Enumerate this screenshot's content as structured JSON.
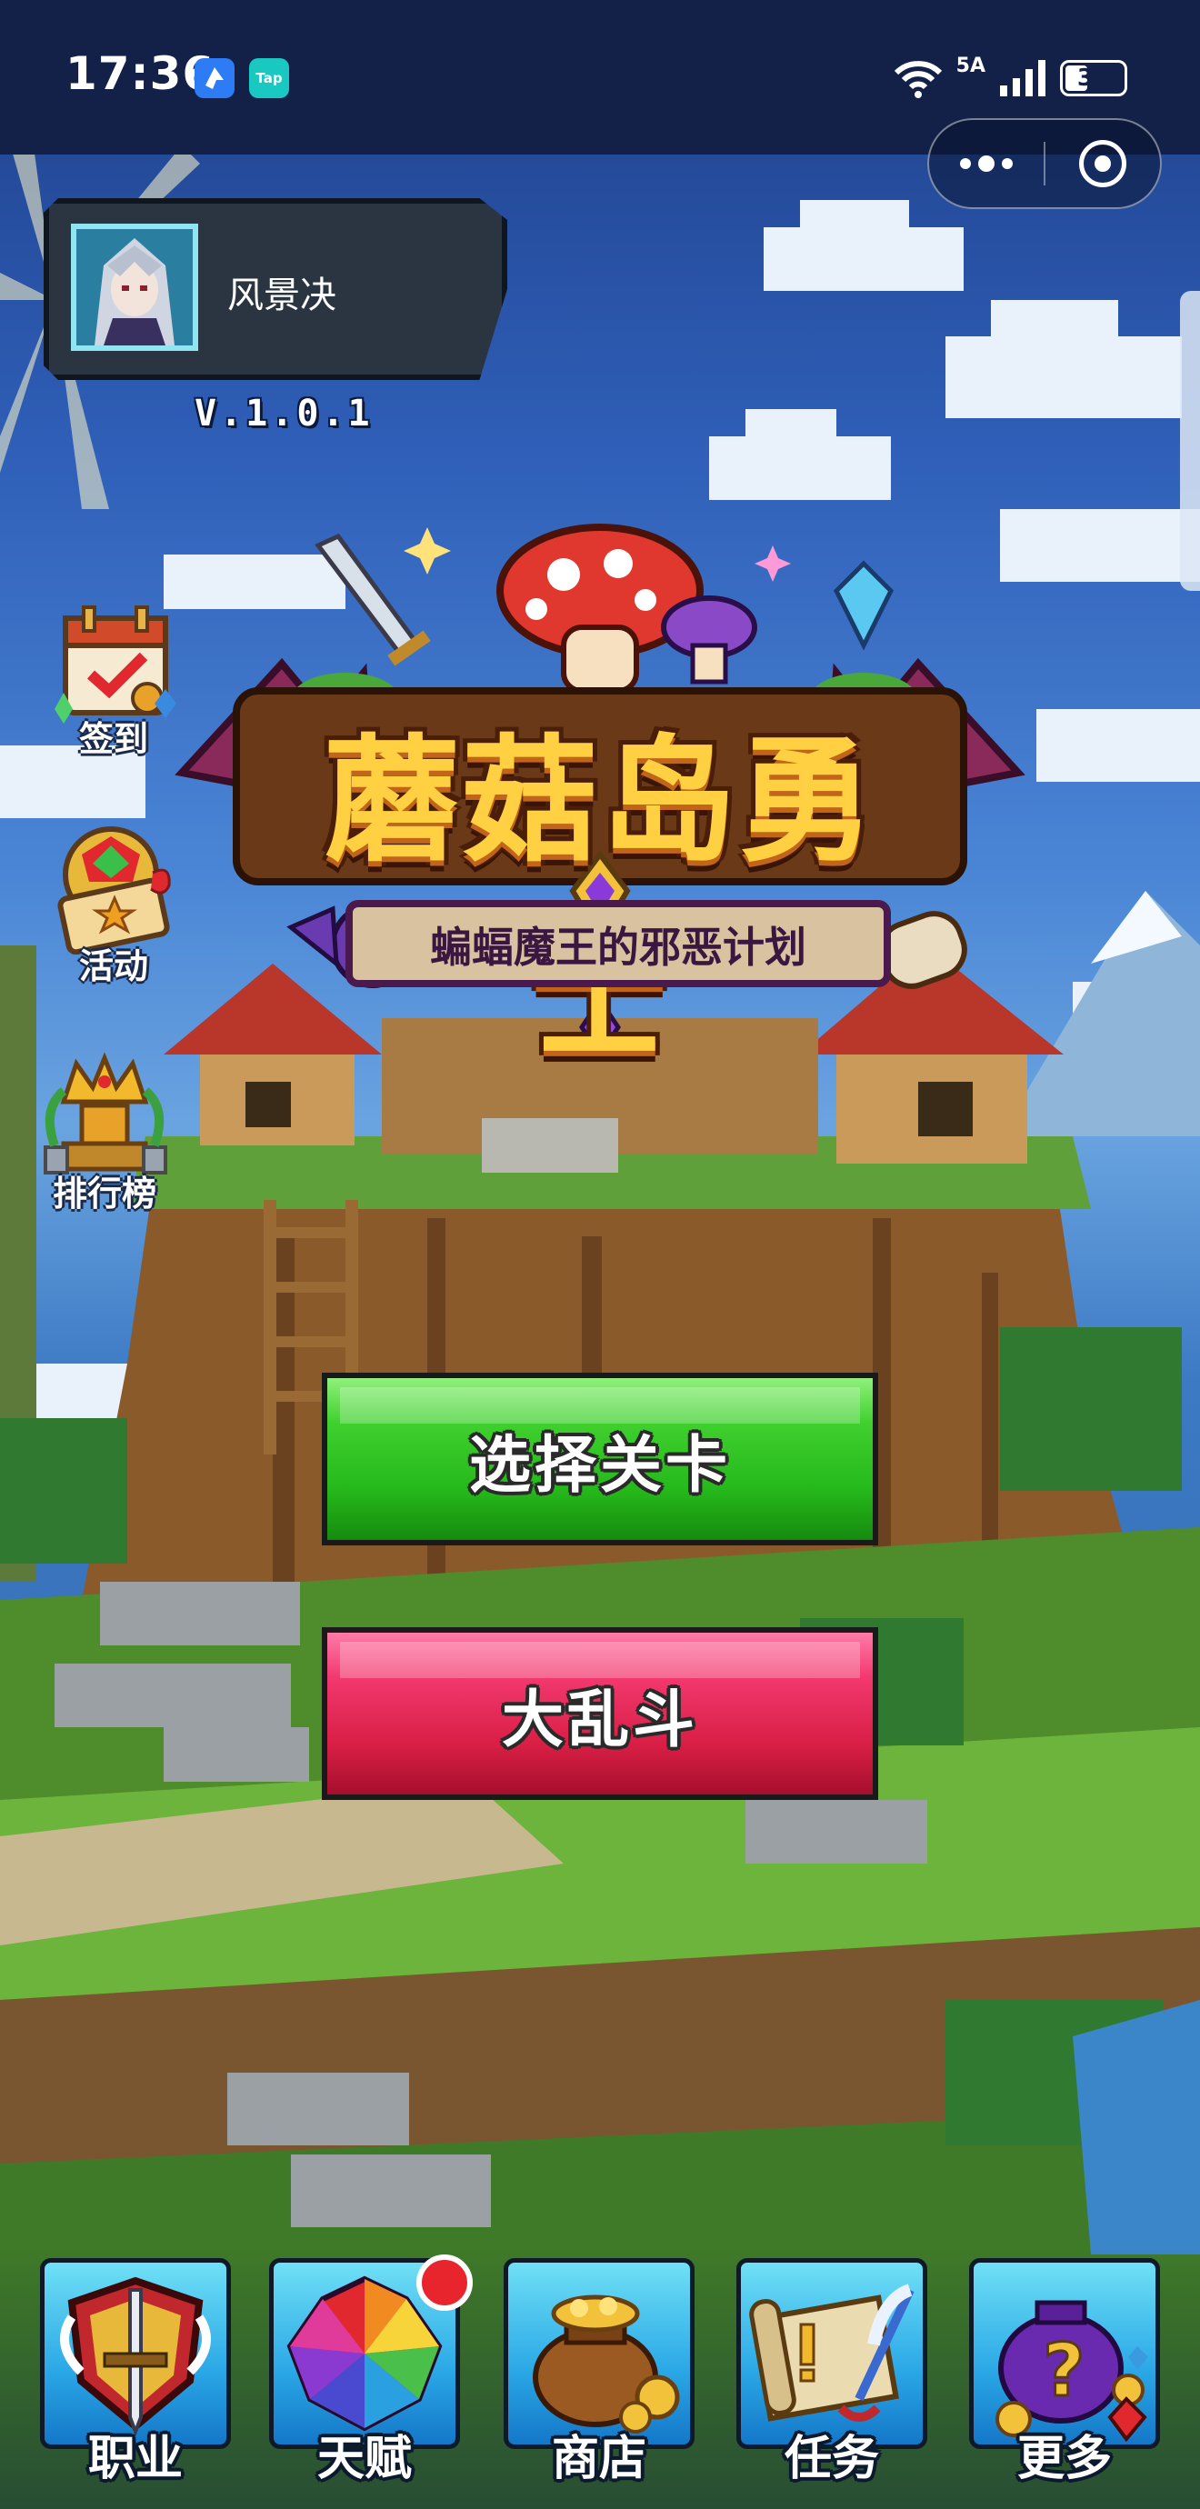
{
  "status_bar": {
    "time": "17:36",
    "app_badge_2": "Tap",
    "network": "5A",
    "battery": "33"
  },
  "player": {
    "name": "风景决",
    "version": "V.1.0.1"
  },
  "side_menu": [
    {
      "label": "签到",
      "icon": "calendar-checkin-icon"
    },
    {
      "label": "活动",
      "icon": "event-ticket-icon"
    },
    {
      "label": "排行榜",
      "icon": "crown-trophy-icon"
    }
  ],
  "logo": {
    "title": "蘑菇岛勇士",
    "subtitle": "蝙蝠魔王的邪恶计划"
  },
  "buttons": {
    "select_stage": "选择关卡",
    "brawl": "大乱斗"
  },
  "bottom_nav": [
    {
      "label": "职业",
      "icon": "shield-sword-icon",
      "badge": false
    },
    {
      "label": "天赋",
      "icon": "rainbow-gem-icon",
      "badge": true
    },
    {
      "label": "商店",
      "icon": "coin-bag-icon",
      "badge": false
    },
    {
      "label": "任务",
      "icon": "scroll-quill-icon",
      "badge": false
    },
    {
      "label": "更多",
      "icon": "mystery-bag-icon",
      "badge": false
    }
  ],
  "colors": {
    "select_button": "#25b81a",
    "brawl_button": "#d81e44",
    "title_gold": "#ffd042",
    "notification_red": "#e8242c"
  }
}
